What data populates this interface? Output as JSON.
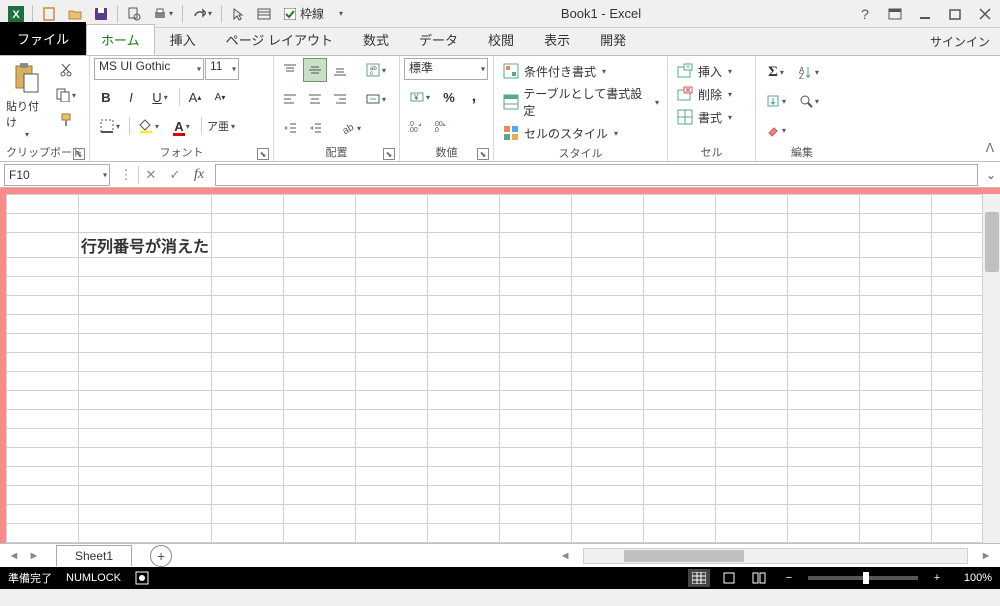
{
  "title": "Book1 - Excel",
  "qat": {
    "borders_label": "枠線"
  },
  "tabs": {
    "file": "ファイル",
    "items": [
      "ホーム",
      "挿入",
      "ページ レイアウト",
      "数式",
      "データ",
      "校閲",
      "表示",
      "開発"
    ],
    "active_index": 0,
    "signin": "サインイン"
  },
  "ribbon": {
    "clipboard": {
      "label": "クリップボード",
      "paste": "貼り付け"
    },
    "font": {
      "label": "フォント",
      "name": "MS UI Gothic",
      "size": "11"
    },
    "alignment": {
      "label": "配置"
    },
    "number": {
      "label": "数値",
      "format": "標準"
    },
    "styles": {
      "label": "スタイル",
      "conditional": "条件付き書式",
      "table": "テーブルとして書式設定",
      "cell": "セルのスタイル"
    },
    "cells": {
      "label": "セル",
      "insert": "挿入",
      "delete": "削除",
      "format": "書式"
    },
    "editing": {
      "label": "編集"
    }
  },
  "namebox": "F10",
  "formula": "",
  "cell_content": "行列番号が消えた",
  "sheet_tab": "Sheet1",
  "status": {
    "ready": "準備完了",
    "numlock": "NUMLOCK",
    "zoom": "100%"
  }
}
